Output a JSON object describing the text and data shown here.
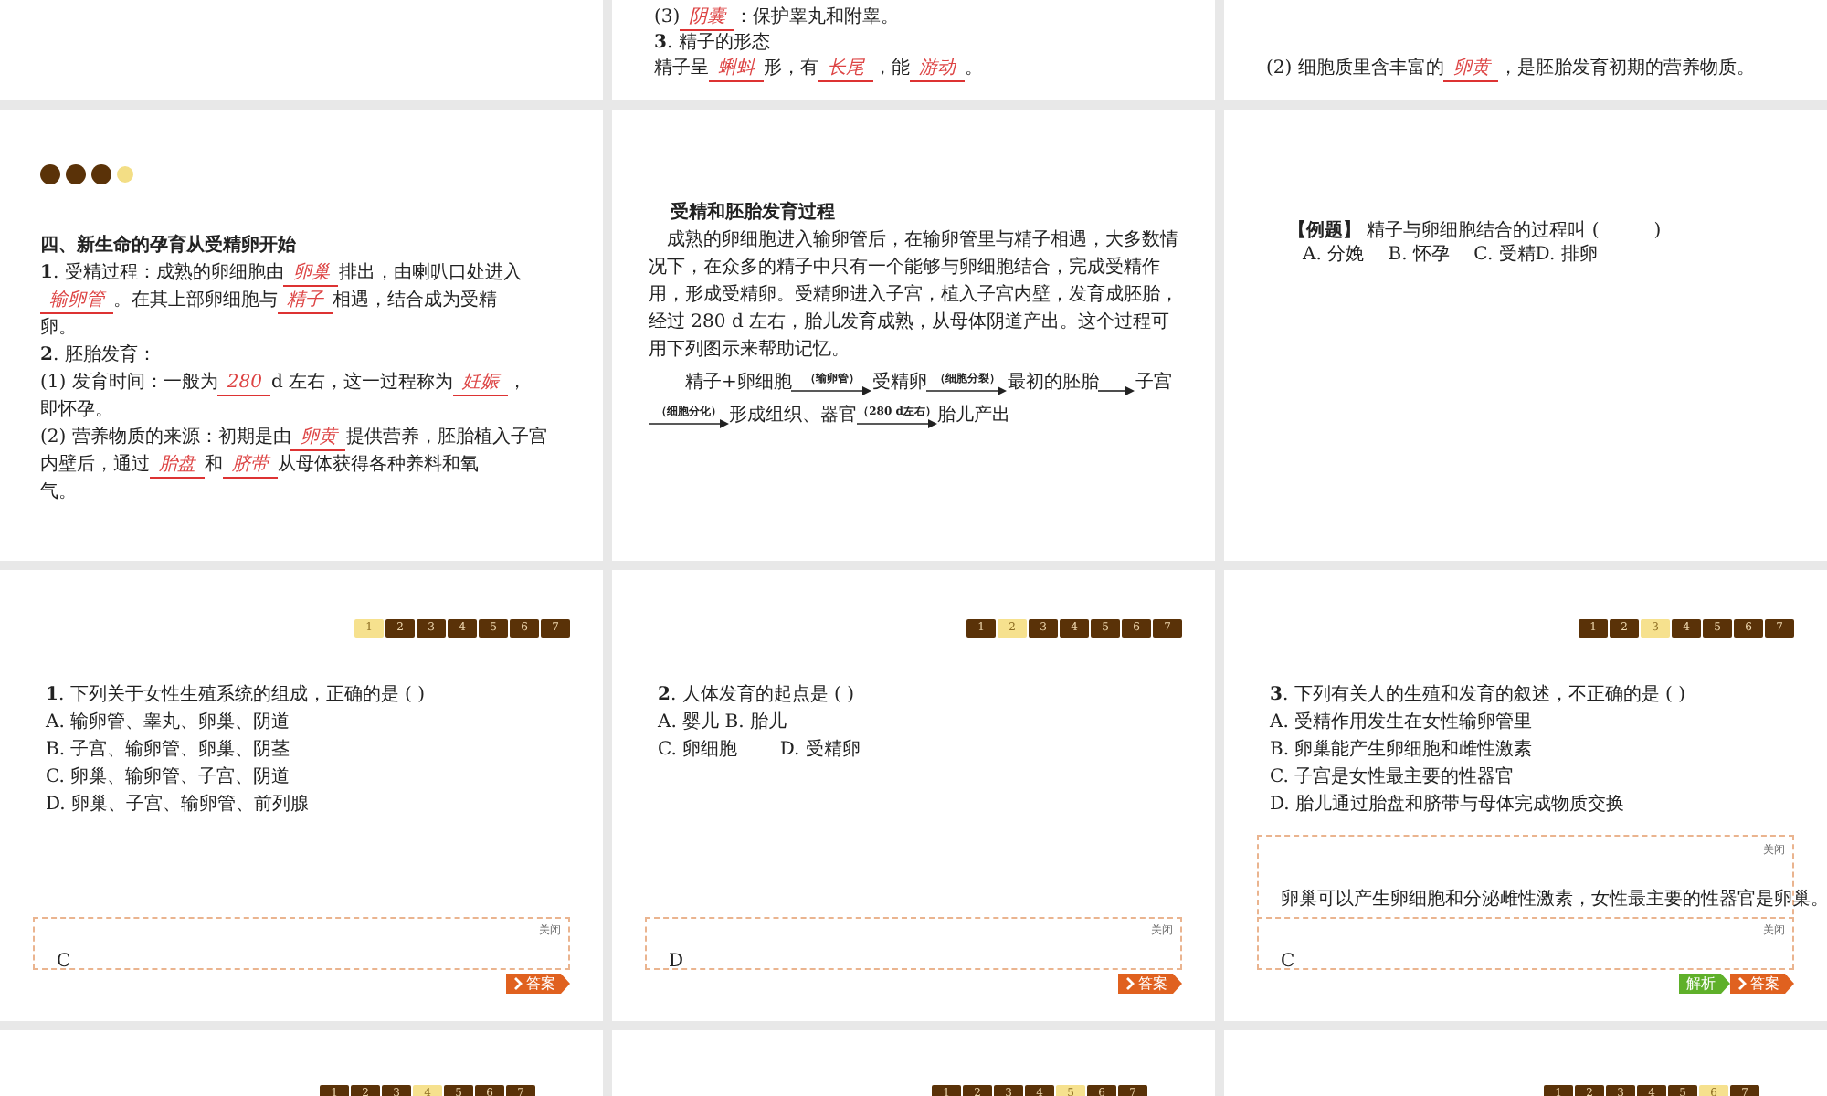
{
  "slides": [
    {
      "kind": "blank"
    },
    {
      "kind": "top_notes",
      "lines": [
        [
          {
            "kind": "text",
            "text": "(3)"
          },
          {
            "kind": "blank",
            "text": "阴囊"
          },
          {
            "kind": "text",
            "text": "：保护睾丸和附睾。"
          }
        ],
        [
          {
            "kind": "text",
            "text": "**3**. 精子的形态"
          }
        ],
        [
          {
            "kind": "text",
            "text": "精子呈"
          },
          {
            "kind": "blank",
            "text": "蝌蚪"
          },
          {
            "kind": "text",
            "text": "形，有"
          },
          {
            "kind": "blank",
            "text": "长尾"
          },
          {
            "kind": "text",
            "text": "，能"
          },
          {
            "kind": "blank",
            "text": "游动"
          },
          {
            "kind": "text",
            "text": "。"
          }
        ]
      ]
    },
    {
      "kind": "top_notes",
      "lines": [
        [
          {
            "kind": "text",
            "text": "(2) 细胞质里含丰富的"
          },
          {
            "kind": "blank",
            "text": "卵黄"
          },
          {
            "kind": "text",
            "text": "，是胚胎发育初期的营养物质。"
          }
        ]
      ]
    },
    {
      "kind": "notes",
      "dots": [
        {
          "color": "#5a3208"
        },
        {
          "color": "#5a3208"
        },
        {
          "color": "#5a3208"
        },
        {
          "color": "#f3de85"
        }
      ],
      "heading": "四、新生命的孕育从受精卵开始",
      "lines": [
        [
          {
            "kind": "text",
            "text": "**1**. 受精过程：成熟的卵细胞由"
          },
          {
            "kind": "blank",
            "text": "卵巢"
          },
          {
            "kind": "text",
            "text": "排出，由喇叭口处进入"
          }
        ],
        [
          {
            "kind": "blank",
            "text": "输卵管"
          },
          {
            "kind": "text",
            "text": "。在其上部卵细胞与"
          },
          {
            "kind": "blank",
            "text": "精子"
          },
          {
            "kind": "text",
            "text": "相遇，结合成为受精"
          }
        ],
        [
          {
            "kind": "text",
            "text": "卵。"
          }
        ],
        [
          {
            "kind": "text",
            "text": "**2**. 胚胎发育："
          }
        ],
        [
          {
            "kind": "text",
            "text": "(1) 发育时间：一般为"
          },
          {
            "kind": "blank",
            "text": "280"
          },
          {
            "kind": "text",
            "text": "d 左右，这一过程称为"
          },
          {
            "kind": "blank",
            "text": "妊娠"
          },
          {
            "kind": "text",
            "text": "，"
          }
        ],
        [
          {
            "kind": "text",
            "text": "即怀孕。"
          }
        ],
        [
          {
            "kind": "text",
            "text": "(2) 营养物质的来源：初期是由"
          },
          {
            "kind": "blank",
            "text": "卵黄"
          },
          {
            "kind": "text",
            "text": "提供营养，胚胎植入子宫"
          }
        ],
        [
          {
            "kind": "text",
            "text": "内壁后，通过"
          },
          {
            "kind": "blank",
            "text": "胎盘"
          },
          {
            "kind": "text",
            "text": "和"
          },
          {
            "kind": "blank",
            "text": "脐带"
          },
          {
            "kind": "text",
            "text": "从母体获得各种养料和氧"
          }
        ],
        [
          {
            "kind": "text",
            "text": "气。"
          }
        ]
      ]
    },
    {
      "kind": "reading",
      "heading": "受精和胚胎发育过程",
      "paragraph": "成熟的卵细胞进入输卵管后，在输卵管里与精子相遇，大多数情况下，在众多的精子中只有一个能够与卵细胞结合，完成受精作用，形成受精卵。受精卵进入子宫，植入子宫内壁，发育成胚胎，经过 280 d 左右，胎儿发育成熟，从母体阴道产出。这个过程可用下列图示来帮助记忆。",
      "flow": [
        [
          {
            "kind": "node",
            "text": "精子+卵细胞"
          },
          {
            "kind": "arrow",
            "label": "（输卵管）"
          },
          {
            "kind": "node",
            "text": "受精卵"
          },
          {
            "kind": "arrow",
            "label": "（细胞分裂）"
          },
          {
            "kind": "node",
            "text": "最初的胚胎"
          },
          {
            "kind": "arrow"
          },
          {
            "kind": "node",
            "text": "子宫"
          }
        ],
        [
          {
            "kind": "arrow",
            "label": "（细胞分化）"
          },
          {
            "kind": "node",
            "text": "形成组织、器官"
          },
          {
            "kind": "arrow",
            "label": "（280 d左右）"
          },
          {
            "kind": "node",
            "text": "胎儿产出"
          }
        ]
      ]
    },
    {
      "kind": "example",
      "question": "**【例题】** 精子与卵细胞结合的过程叫 (　　　)",
      "options": "A. 分娩　 B. 怀孕　 C. 受精D. 排卵"
    },
    {
      "kind": "quiz",
      "nav": [
        {
          "label": "1",
          "selected": true
        },
        {
          "label": "2",
          "selected": false
        },
        {
          "label": "3",
          "selected": false
        },
        {
          "label": "4",
          "selected": false
        },
        {
          "label": "5",
          "selected": false
        },
        {
          "label": "6",
          "selected": false
        },
        {
          "label": "7",
          "selected": false
        }
      ],
      "question": "**1**. 下列关于女性生殖系统的组成，正确的是 ( )",
      "options": [
        "A. 输卵管、睾丸、卵巢、阴道",
        "B. 子宫、输卵管、卵巢、阴茎",
        "C. 卵巢、输卵管、子宫、阴道",
        "D. 卵巢、子宫、输卵管、前列腺"
      ],
      "answer": {
        "close": "关闭",
        "text": "C"
      },
      "buttons": [
        {
          "kind": "answer",
          "label": "答案"
        }
      ]
    },
    {
      "kind": "quiz",
      "nav": [
        {
          "label": "1",
          "selected": false
        },
        {
          "label": "2",
          "selected": true
        },
        {
          "label": "3",
          "selected": false
        },
        {
          "label": "4",
          "selected": false
        },
        {
          "label": "5",
          "selected": false
        },
        {
          "label": "6",
          "selected": false
        },
        {
          "label": "7",
          "selected": false
        }
      ],
      "question": "**2**. 人体发育的起点是 ( )",
      "options": [
        "A. 婴儿  B. 胎儿",
        "C. 卵细胞　　 D. 受精卵"
      ],
      "answer": {
        "close": "关闭",
        "text": "D"
      },
      "buttons": [
        {
          "kind": "answer",
          "label": "答案"
        }
      ]
    },
    {
      "kind": "quiz",
      "nav": [
        {
          "label": "1",
          "selected": false
        },
        {
          "label": "2",
          "selected": false
        },
        {
          "label": "3",
          "selected": true
        },
        {
          "label": "4",
          "selected": false
        },
        {
          "label": "5",
          "selected": false
        },
        {
          "label": "6",
          "selected": false
        },
        {
          "label": "7",
          "selected": false
        }
      ],
      "question": "**3**. 下列有关人的生殖和发育的叙述，不正确的是 ( )",
      "options": [
        "A. 受精作用发生在女性输卵管里",
        "B. 卵巢能产生卵细胞和雌性激素",
        "C. 子宫是女性最主要的性器官",
        "D. 胎儿通过胎盘和脐带与母体完成物质交换"
      ],
      "analysis": {
        "close": "关闭",
        "text": "卵巢可以产生卵细胞和分泌雌性激素，女性最主要的性器官是卵巢。"
      },
      "answer": {
        "close": "关闭",
        "text": "C"
      },
      "buttons": [
        {
          "kind": "analysis",
          "label": "解析"
        },
        {
          "kind": "answer",
          "label": "答案"
        }
      ]
    },
    {
      "kind": "nav_only",
      "nav": [
        {
          "label": "1",
          "selected": false
        },
        {
          "label": "2",
          "selected": false
        },
        {
          "label": "3",
          "selected": false
        },
        {
          "label": "4",
          "selected": true
        },
        {
          "label": "5",
          "selected": false
        },
        {
          "label": "6",
          "selected": false
        },
        {
          "label": "7",
          "selected": false
        }
      ]
    },
    {
      "kind": "nav_only",
      "nav": [
        {
          "label": "1",
          "selected": false
        },
        {
          "label": "2",
          "selected": false
        },
        {
          "label": "3",
          "selected": false
        },
        {
          "label": "4",
          "selected": false
        },
        {
          "label": "5",
          "selected": true
        },
        {
          "label": "6",
          "selected": false
        },
        {
          "label": "7",
          "selected": false
        }
      ]
    },
    {
      "kind": "nav_only",
      "nav": [
        {
          "label": "1",
          "selected": false
        },
        {
          "label": "2",
          "selected": false
        },
        {
          "label": "3",
          "selected": false
        },
        {
          "label": "4",
          "selected": false
        },
        {
          "label": "5",
          "selected": false
        },
        {
          "label": "6",
          "selected": true
        },
        {
          "label": "7",
          "selected": false
        }
      ]
    }
  ]
}
